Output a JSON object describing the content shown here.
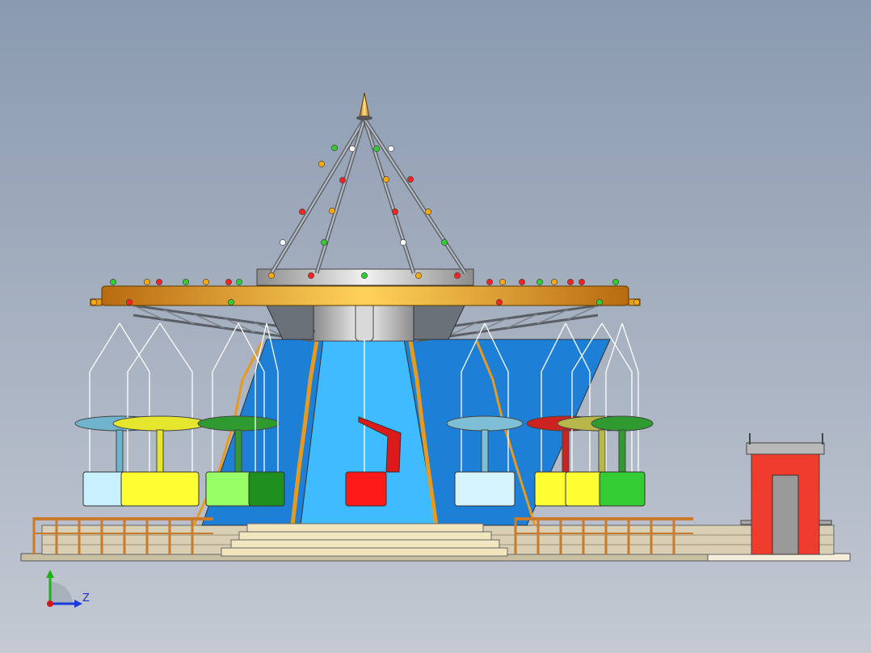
{
  "scene": {
    "subject": "carousel-swing-ride",
    "background_top": "#8a9ab0",
    "background_bottom": "#c4c9d2"
  },
  "colors": {
    "canopy_orange": "#e89a1e",
    "canopy_highlight": "#ffd35a",
    "tower_blue": "#1e7fd6",
    "tower_light_blue": "#3ebcff",
    "frame_gray": "#9aa0a6",
    "railing_brown": "#c97a2a",
    "step_cream": "#f2e6bf",
    "booth_red": "#f03c2c",
    "ground_tan": "#c9bfa3"
  },
  "seat_colors": [
    "#c8f0ff",
    "#ffff33",
    "#99ff66",
    "#1f8f1f",
    "#ff1a1a",
    "#d6f4ff",
    "#ffff33",
    "#33cc33"
  ],
  "canopy_colors": [
    "#6fb3cc",
    "#e6e62e",
    "#2f9a2f",
    "#7fbfd6",
    "#cc2222",
    "#b8b84a",
    "#2f9a2f"
  ],
  "axis_triad": {
    "label": "Z",
    "icon": "axis-triad-icon"
  }
}
